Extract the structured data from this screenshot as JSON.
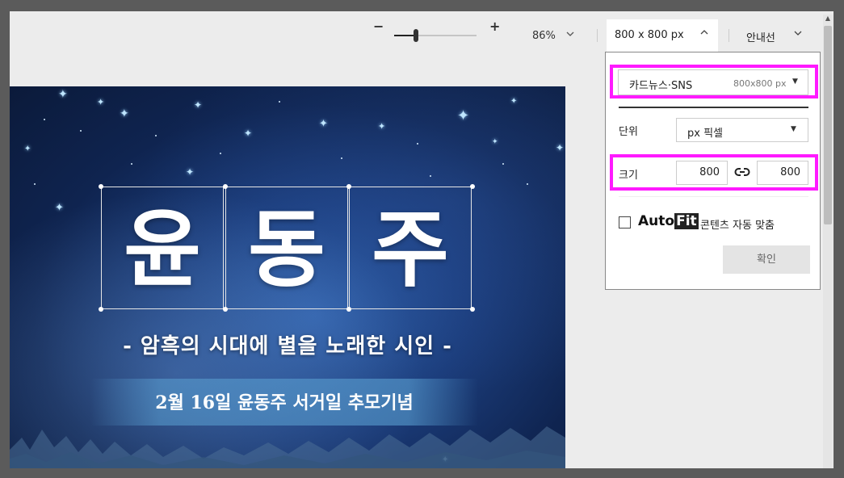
{
  "toolbar": {
    "zoom_minus": "−",
    "zoom_plus": "+",
    "zoom_value": "86%",
    "zoom_slider_percent": 26,
    "size_label": "800 x 800 px",
    "guide_label": "안내선"
  },
  "canvas": {
    "title_chars": [
      "윤",
      "동",
      "주"
    ],
    "subtitle": "- 암흑의 시대에 별을 노래한 시인 -",
    "banner": "2월 16일 윤동주 서거일 추모기념"
  },
  "size_panel": {
    "preset_name": "카드뉴스·SNS",
    "preset_size": "800x800 px",
    "unit_label": "단위",
    "unit_value": "px 픽셀",
    "size_label": "크기",
    "width": "800",
    "height": "800",
    "autofit_logo": "AutoFit",
    "autofit_label": "콘텐츠 자동 맞춤",
    "autofit_checked": false,
    "confirm_label": "확인"
  },
  "colors": {
    "highlight": "#ff1aff",
    "canvas_bg": "#1b3c7a",
    "window_bg": "#ececec"
  }
}
